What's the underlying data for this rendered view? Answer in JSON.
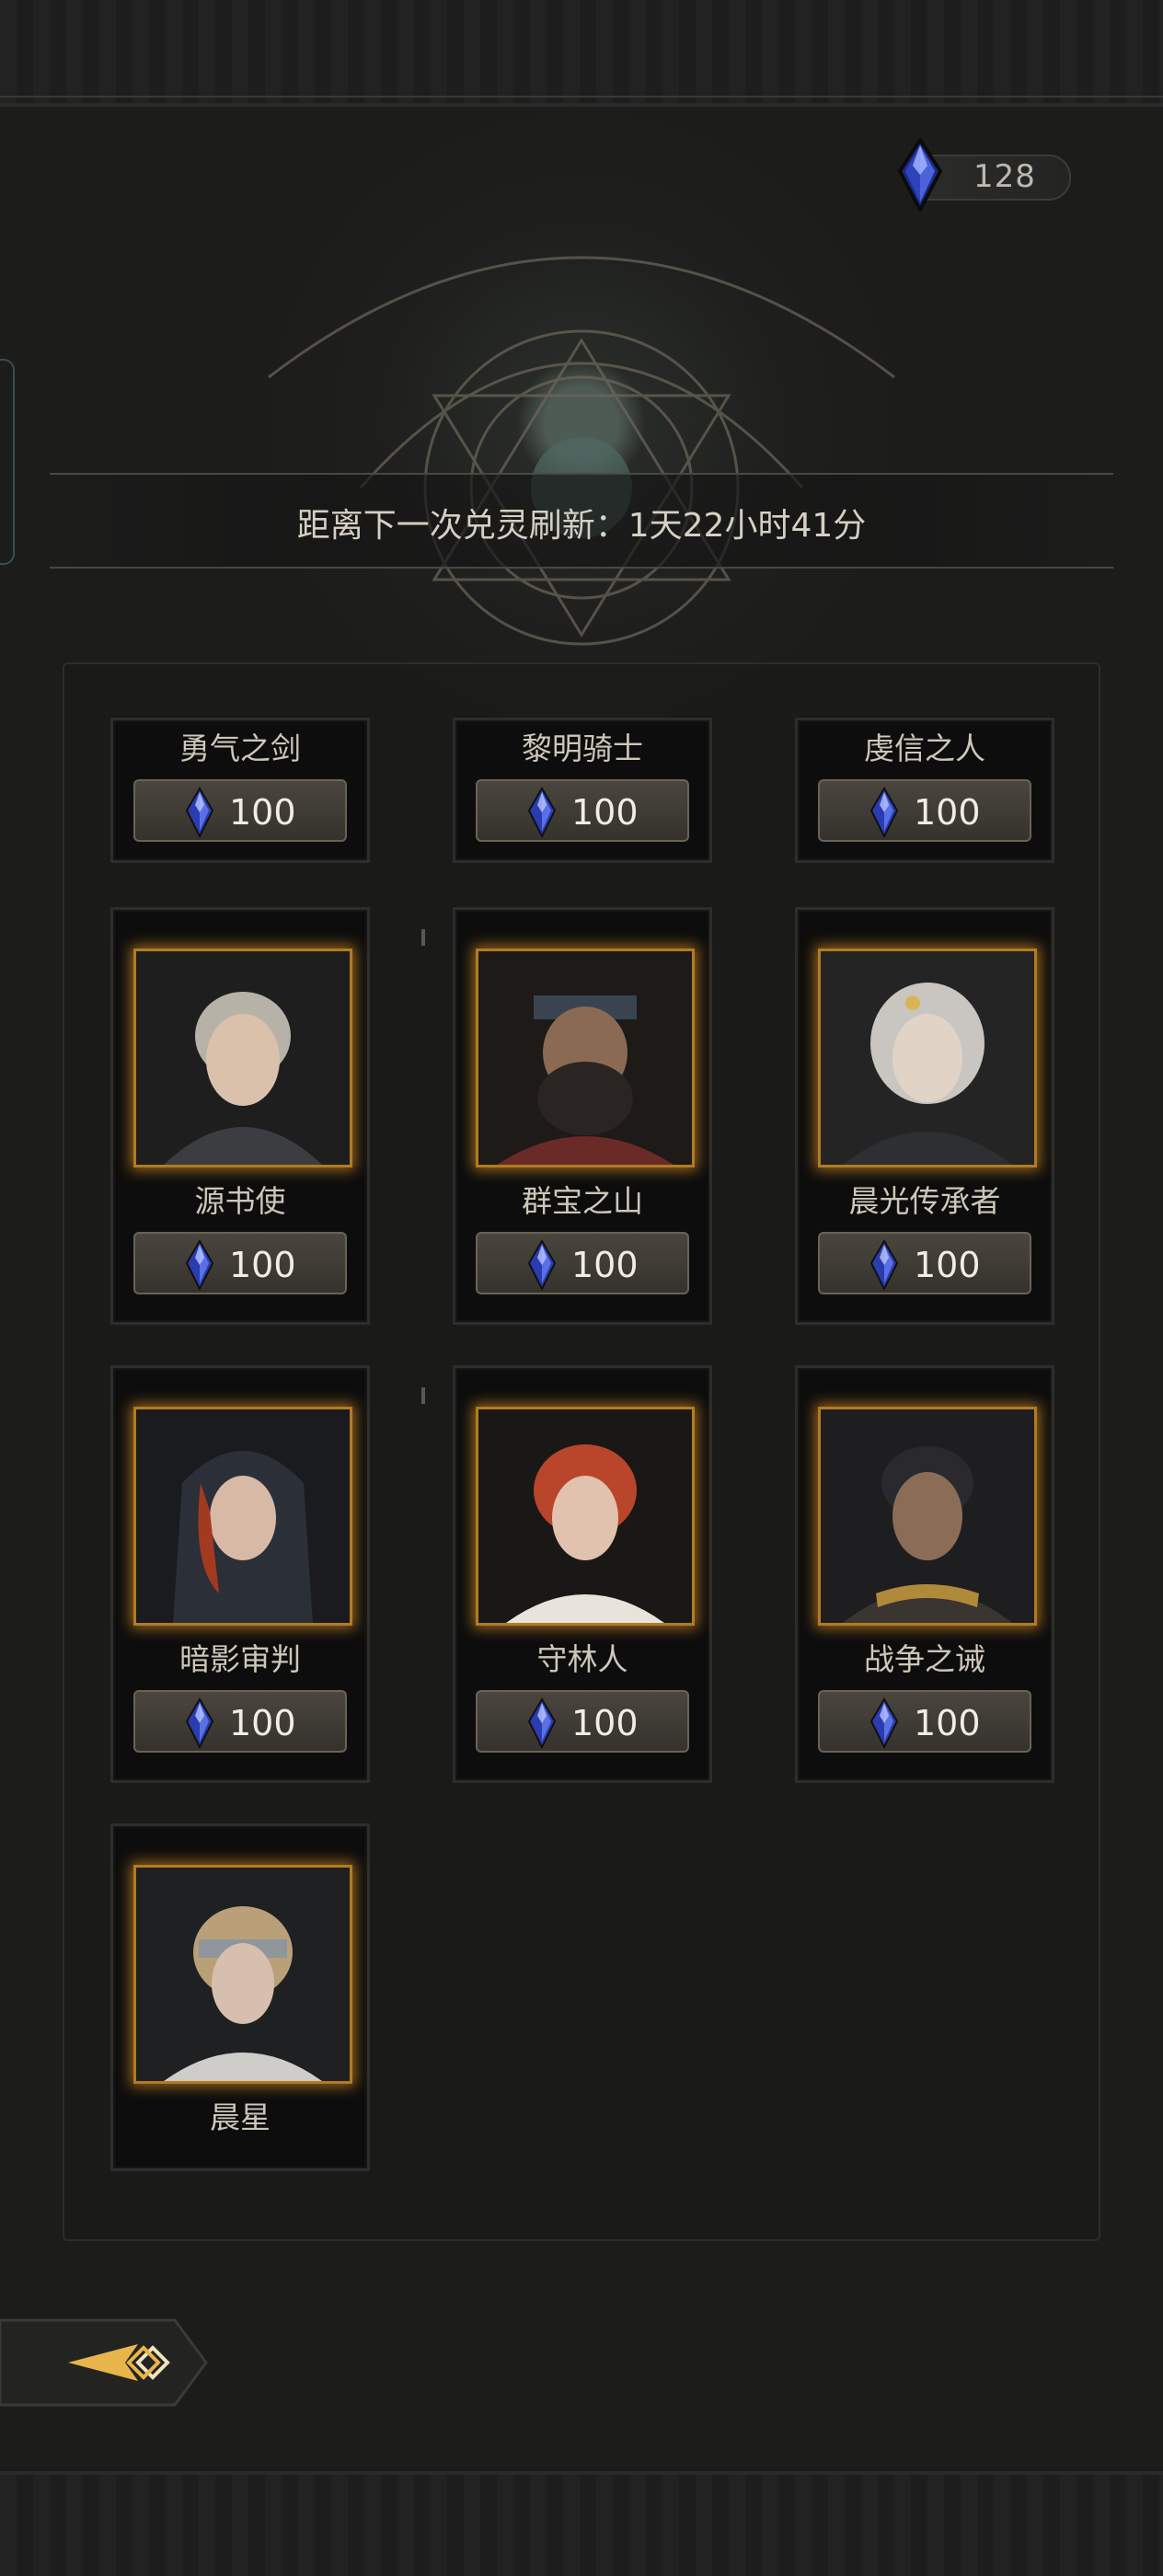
{
  "header": {
    "currency_amount": "128",
    "currency_icon": "blue-crystal-icon"
  },
  "refresh": {
    "text": "距离下一次兑灵刷新：1天22小时41分"
  },
  "colors": {
    "frame_gold": "#b27b22",
    "crystal_blue": "#3a4fc0",
    "button_bg": "#4a463e"
  },
  "cards": [
    {
      "name": "勇气之剑",
      "price": "100"
    },
    {
      "name": "黎明骑士",
      "price": "100"
    },
    {
      "name": "虔信之人",
      "price": "100"
    },
    {
      "name": "源书使",
      "price": "100"
    },
    {
      "name": "群宝之山",
      "price": "100"
    },
    {
      "name": "晨光传承者",
      "price": "100"
    },
    {
      "name": "暗影审判",
      "price": "100"
    },
    {
      "name": "守林人",
      "price": "100"
    },
    {
      "name": "战争之诫",
      "price": "100"
    },
    {
      "name": "晨星"
    }
  ],
  "footer": {
    "back_icon": "back-arrow-icon"
  }
}
